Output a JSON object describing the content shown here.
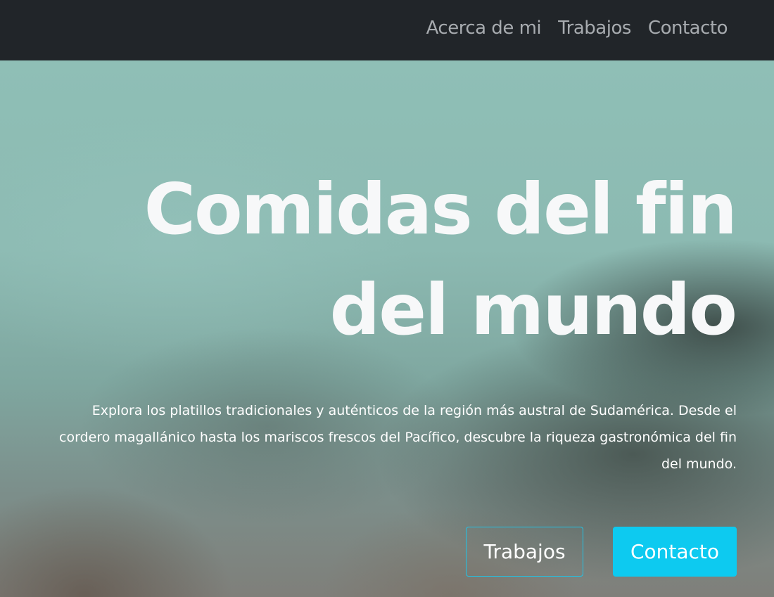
{
  "nav": {
    "links": [
      {
        "label": "Acerca de mi"
      },
      {
        "label": "Trabajos"
      },
      {
        "label": "Contacto"
      }
    ]
  },
  "hero": {
    "title": "Comidas del fin del mundo",
    "text": "Explora los platillos tradicionales y auténticos de la región más austral de Sudamérica. Desde el\ncordero magallánico hasta los mariscos frescos del Pacífico, descubre la riqueza gastronómica del fin\ndel mundo.",
    "buttons": {
      "secondary_label": "Trabajos",
      "primary_label": "Contacto"
    }
  },
  "colors": {
    "navbar_bg": "#212529",
    "accent": "#0dcaf0"
  }
}
